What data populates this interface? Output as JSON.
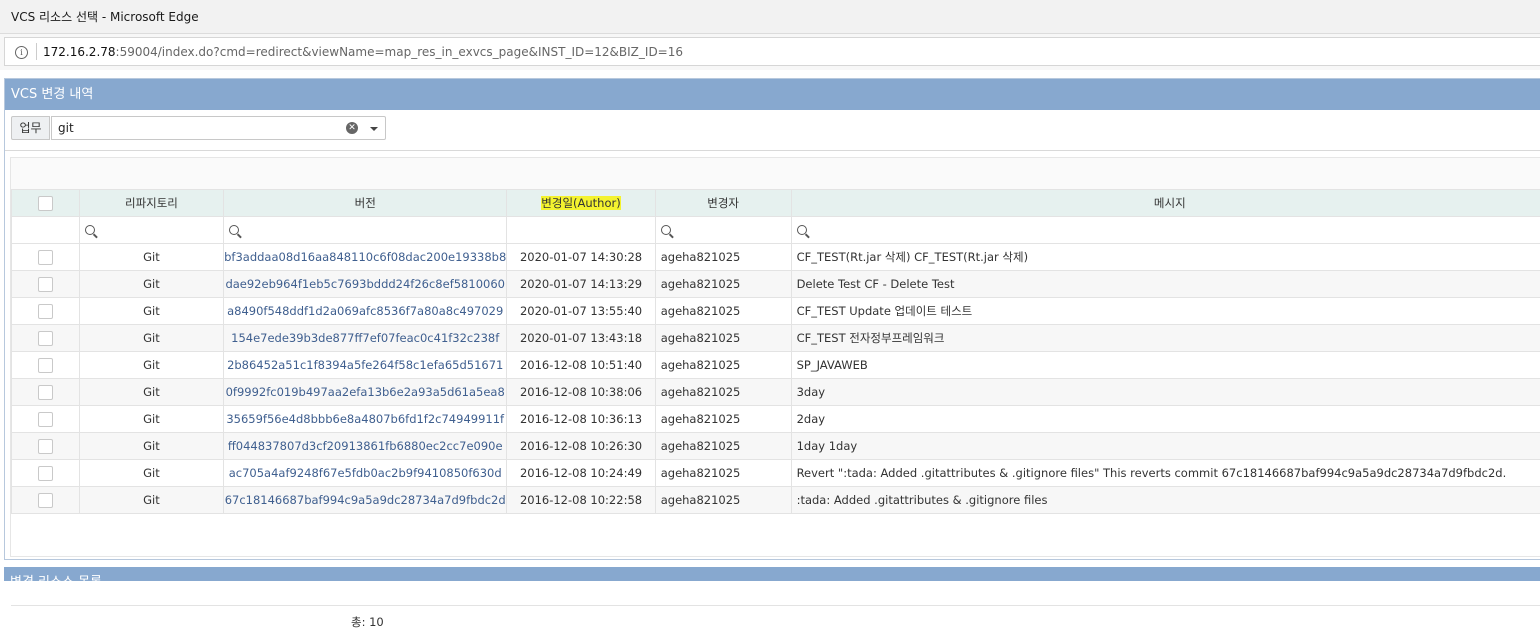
{
  "window": {
    "title": "VCS 리소스 선택 - Microsoft Edge"
  },
  "address": {
    "host": "172.16.2.78",
    "rest": ":59004/index.do?cmd=redirect&viewName=map_res_in_exvcs_page&INST_ID=12&BIZ_ID=16"
  },
  "panel": {
    "title": "VCS 변경 내역"
  },
  "filter": {
    "label": "업무",
    "value": "git"
  },
  "grid": {
    "columns": {
      "repo": "리파지토리",
      "version": "버전",
      "date": "변경일(Author)",
      "author": "변경자",
      "message": "메시지"
    },
    "rows": [
      {
        "repo": "Git",
        "version": "bf3addaa08d16aa848110c6f08dac200e19338b8",
        "date": "2020-01-07 14:30:28",
        "author": "ageha821025",
        "message": "CF_TEST(Rt.jar 삭제) CF_TEST(Rt.jar 삭제)"
      },
      {
        "repo": "Git",
        "version": "dae92eb964f1eb5c7693bddd24f26c8ef5810060",
        "date": "2020-01-07 14:13:29",
        "author": "ageha821025",
        "message": "Delete Test CF - Delete Test"
      },
      {
        "repo": "Git",
        "version": "a8490f548ddf1d2a069afc8536f7a80a8c497029",
        "date": "2020-01-07 13:55:40",
        "author": "ageha821025",
        "message": "CF_TEST Update 업데이트 테스트"
      },
      {
        "repo": "Git",
        "version": "154e7ede39b3de877ff7ef07feac0c41f32c238f",
        "date": "2020-01-07 13:43:18",
        "author": "ageha821025",
        "message": "CF_TEST 전자정부프레임워크"
      },
      {
        "repo": "Git",
        "version": "2b86452a51c1f8394a5fe264f58c1efa65d51671",
        "date": "2016-12-08 10:51:40",
        "author": "ageha821025",
        "message": "SP_JAVAWEB"
      },
      {
        "repo": "Git",
        "version": "0f9992fc019b497aa2efa13b6e2a93a5d61a5ea8",
        "date": "2016-12-08 10:38:06",
        "author": "ageha821025",
        "message": "3day"
      },
      {
        "repo": "Git",
        "version": "35659f56e4d8bbb6e8a4807b6fd1f2c74949911f",
        "date": "2016-12-08 10:36:13",
        "author": "ageha821025",
        "message": "2day"
      },
      {
        "repo": "Git",
        "version": "ff044837807d3cf20913861fb6880ec2cc7e090e",
        "date": "2016-12-08 10:26:30",
        "author": "ageha821025",
        "message": "1day 1day"
      },
      {
        "repo": "Git",
        "version": "ac705a4af9248f67e5fdb0ac2b9f9410850f630d",
        "date": "2016-12-08 10:24:49",
        "author": "ageha821025",
        "message": "Revert \":tada: Added .gitattributes & .gitignore files\" This reverts commit 67c18146687baf994c9a5a9dc28734a7d9fbdc2d."
      },
      {
        "repo": "Git",
        "version": "67c18146687baf994c9a5a9dc28734a7d9fbdc2d",
        "date": "2016-12-08 10:22:58",
        "author": "ageha821025",
        "message": ":tada: Added .gitattributes & .gitignore files"
      }
    ],
    "total": "총: 10"
  },
  "panel2": {
    "title": "변경 리소스 목록"
  }
}
